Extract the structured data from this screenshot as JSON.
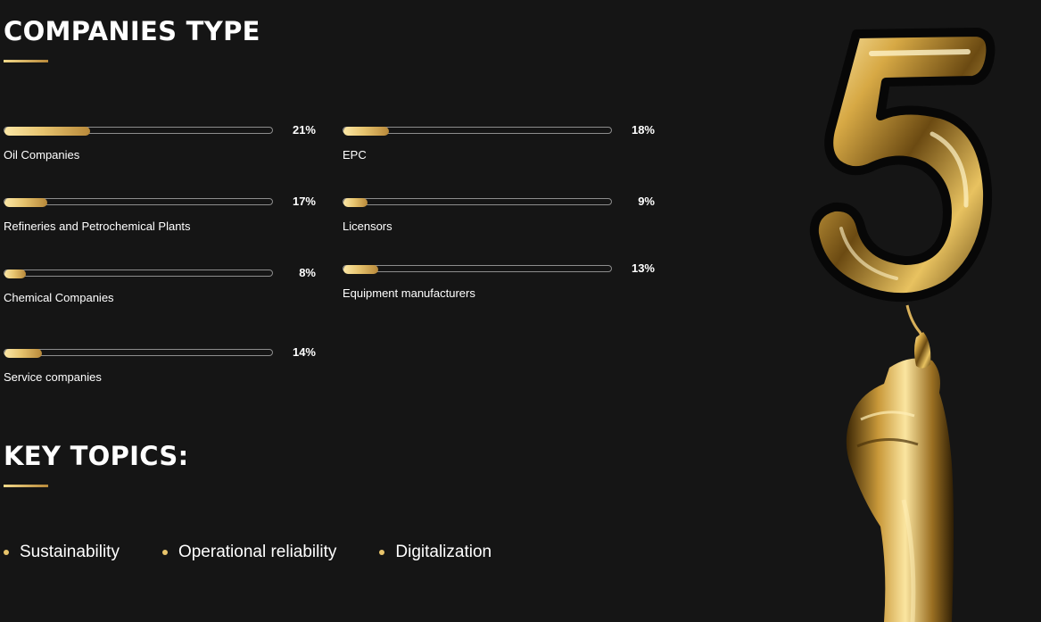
{
  "companies_section": {
    "title": "COMPANIES TYPE",
    "items": [
      {
        "label": "Oil Companies",
        "percent_text": "21%",
        "value": 32
      },
      {
        "label": "EPC",
        "percent_text": "18%",
        "value": 17
      },
      {
        "label": "Refineries and Petrochemical Plants",
        "percent_text": "17%",
        "value": 16
      },
      {
        "label": "Licensors",
        "percent_text": "9%",
        "value": 9
      },
      {
        "label": "Chemical Companies",
        "percent_text": "8%",
        "value": 8
      },
      {
        "label": "Equipment manufacturers",
        "percent_text": "13%",
        "value": 13
      },
      {
        "label": "Service companies",
        "percent_text": "14%",
        "value": 14
      }
    ]
  },
  "topics_section": {
    "title": "KEY TOPICS:",
    "items": [
      "Sustainability",
      "Operational reliability",
      "Digitalization"
    ]
  },
  "colors": {
    "background": "#151515",
    "accent_gold": "#e6c36e",
    "text": "#ffffff"
  },
  "illustration": {
    "icon": "gold-number-five-balloon-held-by-gold-hand"
  }
}
